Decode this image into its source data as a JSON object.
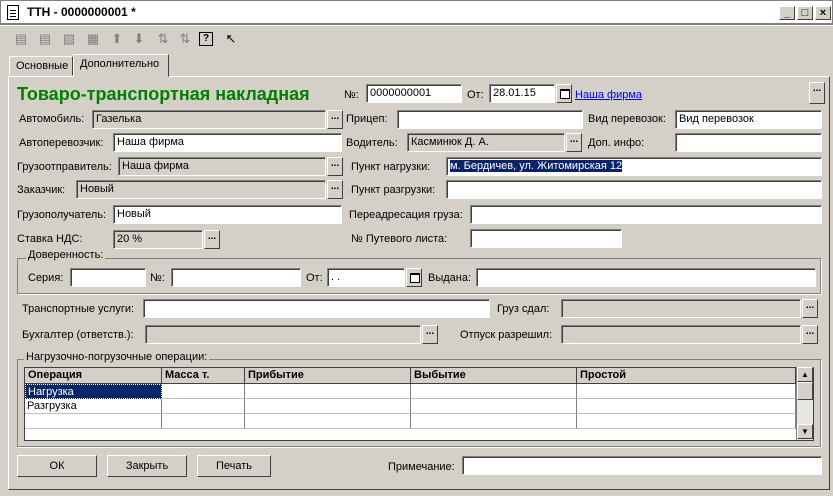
{
  "window": {
    "title": "ТТН - 0000000001 *",
    "min": "_",
    "max": "□",
    "close": "×"
  },
  "toolbar": {
    "icons": [
      "add-icon",
      "copy-icon",
      "edit-icon",
      "delete-icon",
      "move-up-icon",
      "move-down-icon",
      "sort-asc-icon",
      "sort-desc-icon",
      "help-icon",
      "context-help-icon"
    ]
  },
  "tabs": [
    {
      "label": "Основные"
    },
    {
      "label": "Дополнительно"
    }
  ],
  "form": {
    "heading": "Товаро-транспортная накладная",
    "number_label": "№:",
    "number_value": "0000000001",
    "date_label": "От:",
    "date_value": "28.01.15",
    "company_link": "Наша фирма",
    "car_label": "Автомобиль:",
    "car_value": "Газелька",
    "trailer_label": "Прицеп:",
    "trailer_value": "",
    "transport_type_label": "Вид перевозок:",
    "transport_type_value": "Вид перевозок",
    "carrier_label": "Автоперевозчик:",
    "carrier_value": "Наша фирма",
    "driver_label": "Водитель:",
    "driver_value": "Касминюк Д. А.",
    "extra_info_label": "Доп. инфо:",
    "extra_info_value": "",
    "shipper_label": "Грузоотправитель:",
    "shipper_value": "Наша фирма",
    "loading_point_label": "Пункт нагрузки:",
    "loading_point_value": "м. Бердичев, ул. Житомирская 12",
    "customer_label": "Заказчик:",
    "customer_value": "Новый",
    "unloading_point_label": "Пункт разгрузки:",
    "unloading_point_value": "",
    "consignee_label": "Грузополучатель:",
    "consignee_value": "Новый",
    "readdressing_label": "Переадресация груза:",
    "readdressing_value": "",
    "vat_label": "Ставка НДС:",
    "vat_value": "20 %",
    "waybill_label": "№ Путевого листа:",
    "waybill_value": ""
  },
  "power_of_attorney": {
    "title": "Доверенность:",
    "series_label": "Серия:",
    "series_value": "",
    "number_label": "№:",
    "number_value": "",
    "date_label": "От:",
    "date_value": " .  .",
    "issued_label": "Выдана:",
    "issued_value": ""
  },
  "services": {
    "transport_services_label": "Транспортные услуги:",
    "transport_services_value": "",
    "cargo_handed_label": "Груз сдал:",
    "cargo_handed_value": "",
    "accountant_label": "Бухгалтер (ответств.):",
    "accountant_value": "",
    "release_label": "Отпуск разрешил:",
    "release_value": ""
  },
  "operations": {
    "title": "Нагрузочно-погрузочные операции:",
    "columns": [
      "Операция",
      "Масса т.",
      "Прибытие",
      "Выбытие",
      "Простой"
    ],
    "rows": [
      [
        "Нагрузка",
        "",
        "",
        "",
        ""
      ],
      [
        "Разгрузка",
        "",
        "",
        "",
        ""
      ],
      [
        "",
        "",
        "",
        "",
        ""
      ]
    ]
  },
  "footer": {
    "ok": "ОК",
    "close": "Закрыть",
    "print": "Печать",
    "note_label": "Примечание:",
    "note_value": ""
  }
}
